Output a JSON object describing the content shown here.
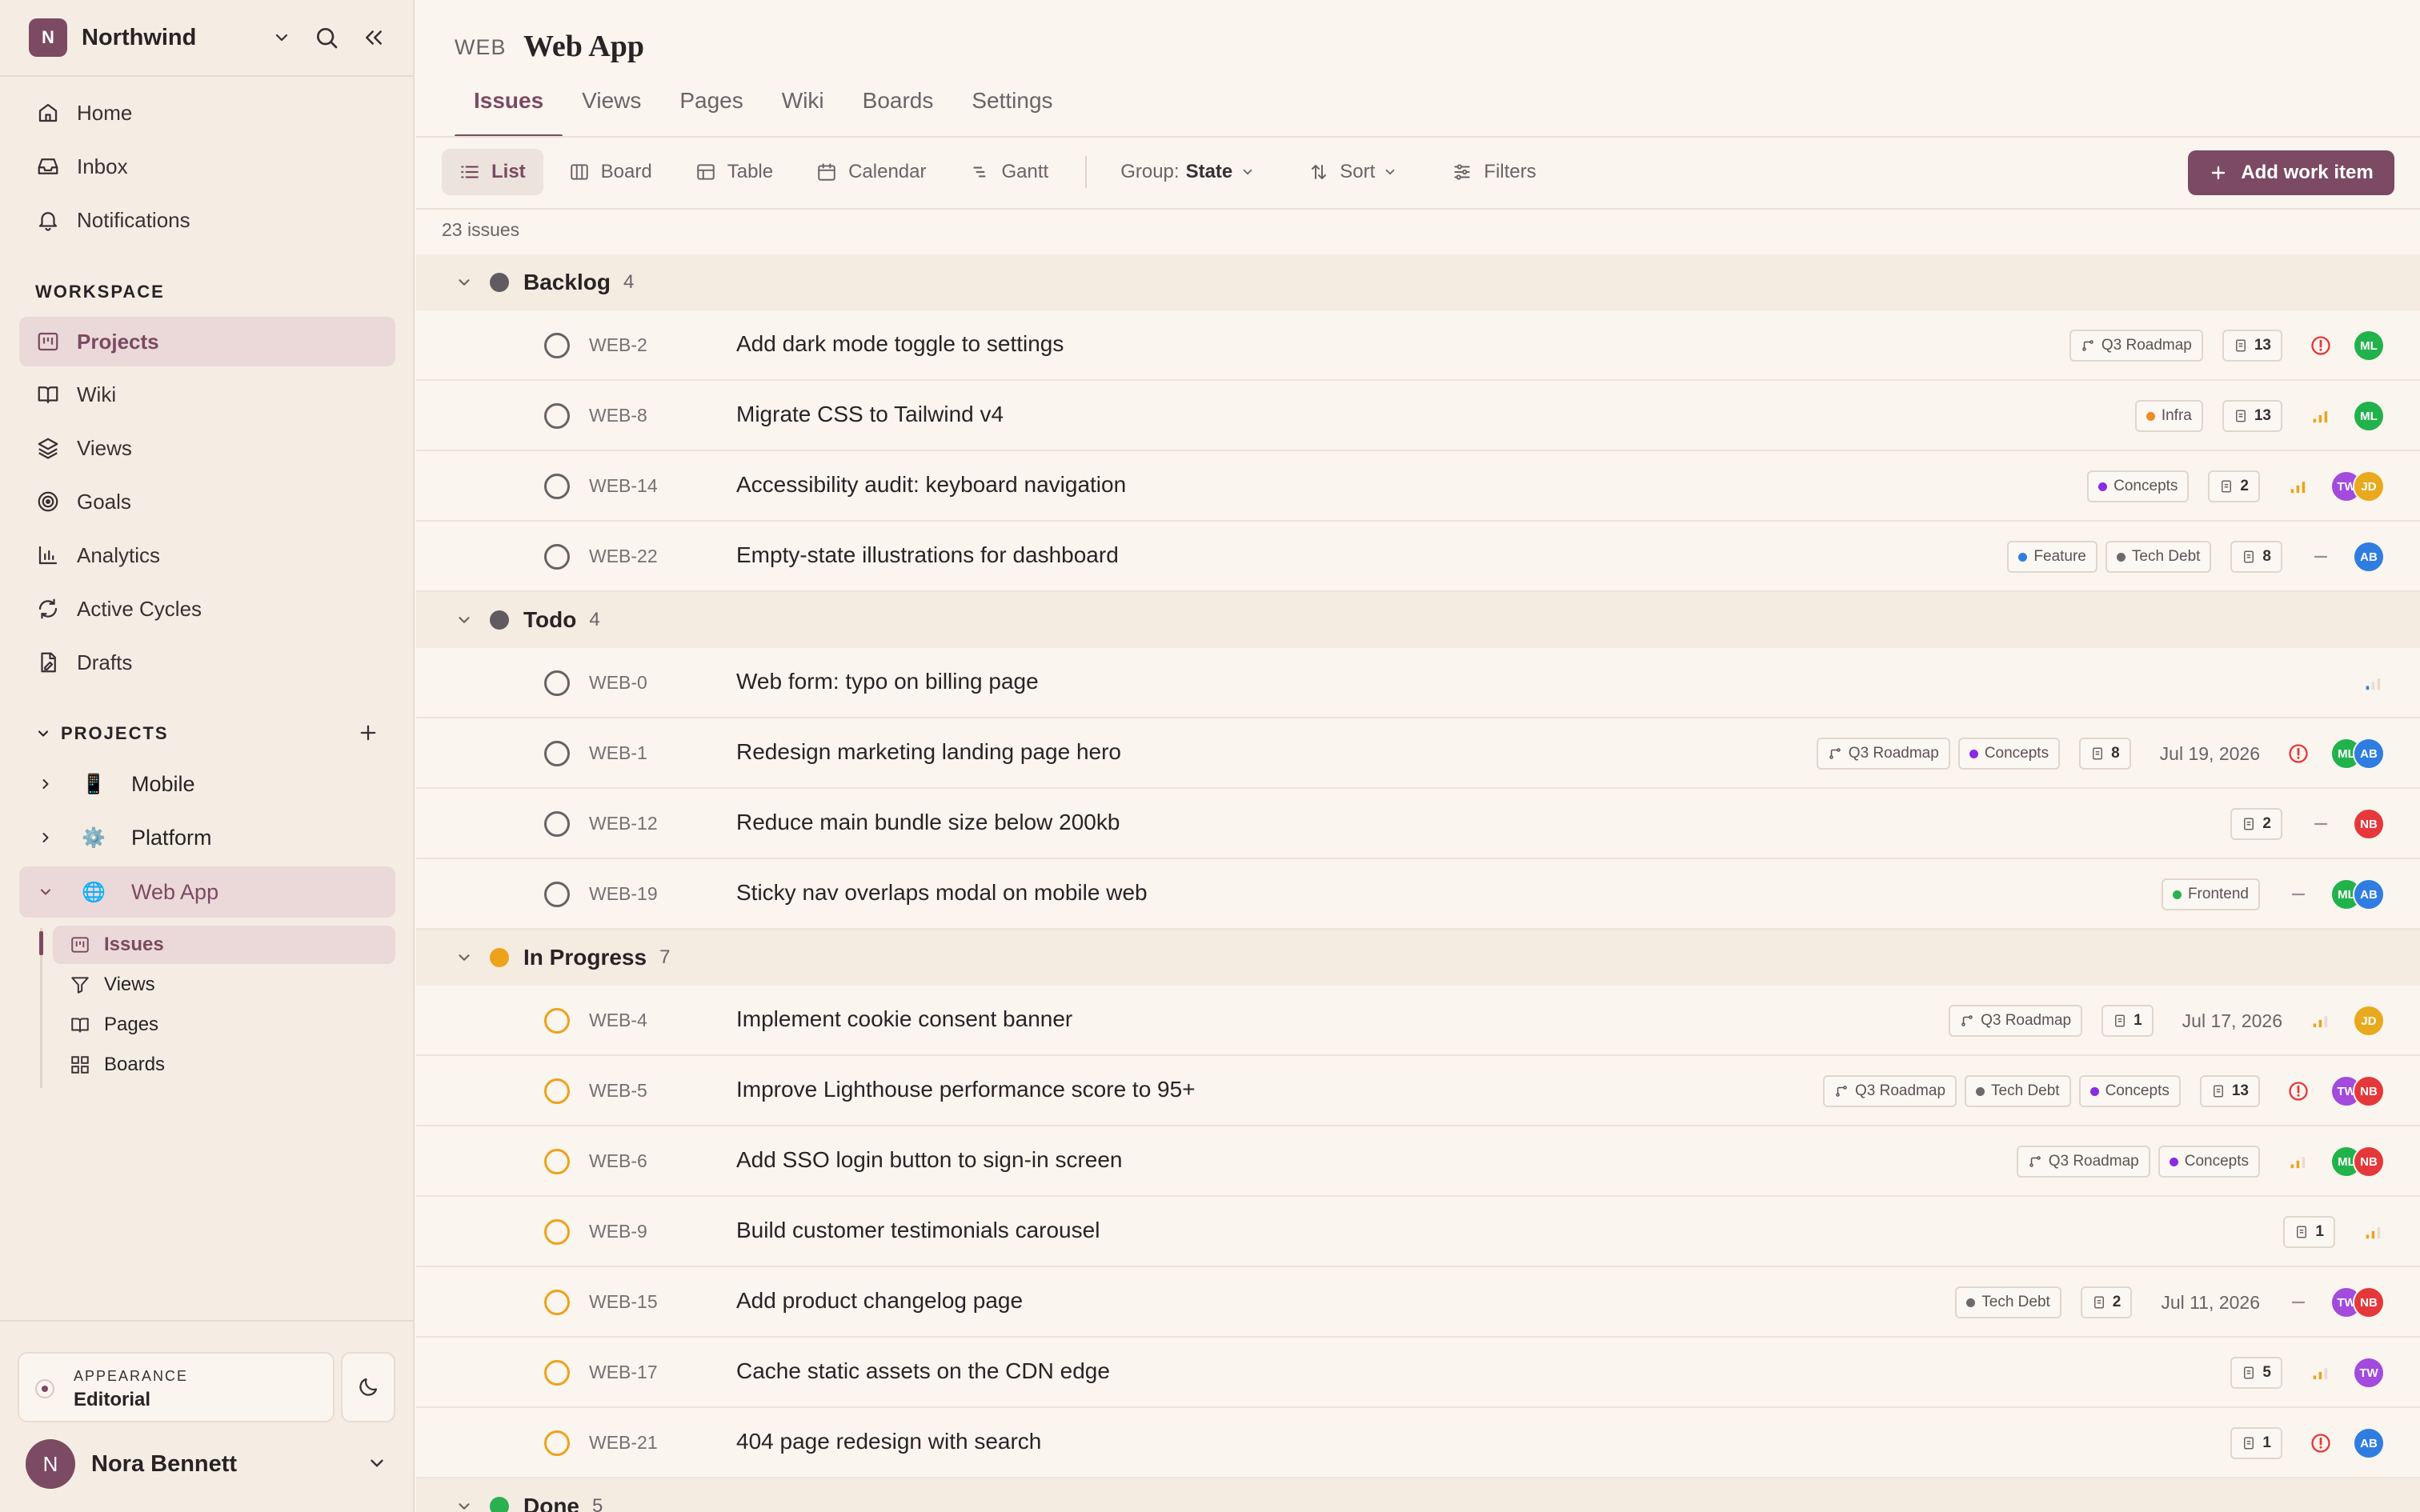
{
  "workspace": {
    "initial": "N",
    "name": "Northwind"
  },
  "nav": [
    {
      "label": "Home",
      "icon": "home-icon"
    },
    {
      "label": "Inbox",
      "icon": "inbox-icon"
    },
    {
      "label": "Notifications",
      "icon": "bell-icon"
    }
  ],
  "workspace_section": {
    "label": "WORKSPACE",
    "items": [
      {
        "label": "Projects",
        "icon": "projects-icon",
        "active": true
      },
      {
        "label": "Wiki",
        "icon": "book-icon"
      },
      {
        "label": "Views",
        "icon": "layers-icon"
      },
      {
        "label": "Goals",
        "icon": "target-icon"
      },
      {
        "label": "Analytics",
        "icon": "chart-icon"
      },
      {
        "label": "Active Cycles",
        "icon": "cycle-icon"
      },
      {
        "label": "Drafts",
        "icon": "draft-icon"
      }
    ]
  },
  "projects_section": {
    "label": "PROJECTS",
    "projects": [
      {
        "label": "Mobile",
        "icon": "📱"
      },
      {
        "label": "Platform",
        "icon": "⚙️"
      },
      {
        "label": "Web App",
        "icon": "🌐"
      }
    ],
    "sub_items": [
      {
        "label": "Issues",
        "icon": "issues-icon"
      },
      {
        "label": "Views",
        "icon": "filter-icon"
      },
      {
        "label": "Pages",
        "icon": "pages-icon"
      },
      {
        "label": "Boards",
        "icon": "grid-icon"
      }
    ]
  },
  "appearance": {
    "label": "APPEARANCE",
    "value": "Editorial"
  },
  "user": {
    "initial": "N",
    "name": "Nora Bennett"
  },
  "header": {
    "project_id": "WEB",
    "project_name": "Web App"
  },
  "tabs": [
    "Issues",
    "Views",
    "Pages",
    "Wiki",
    "Boards",
    "Settings"
  ],
  "toolbar": {
    "layouts": [
      "List",
      "Board",
      "Table",
      "Calendar",
      "Gantt"
    ],
    "group_label": "Group:",
    "group_value": "State",
    "sort_label": "Sort",
    "filters_label": "Filters",
    "add_label": "Add work item"
  },
  "issue_count": "23 issues",
  "colors": {
    "accent": "#7c4a62",
    "backlog": "#5f5b60",
    "todo": "#5f5b60",
    "in_progress": "#eda21c",
    "done": "#2bb04f"
  },
  "groups": [
    {
      "name": "Backlog",
      "count": "4",
      "state": "backlog",
      "issues": [
        {
          "id": "WEB-2",
          "title": "Add dark mode toggle to settings",
          "cycle": "Q3 Roadmap",
          "labels": [],
          "sub": "13",
          "date": "",
          "priority": "urgent",
          "assignees": [
            "ML"
          ]
        },
        {
          "id": "WEB-8",
          "title": "Migrate CSS to Tailwind v4",
          "cycle": "",
          "labels": [
            {
              "name": "Infra",
              "color": "#f08a24"
            }
          ],
          "sub": "13",
          "date": "",
          "priority": "high",
          "assignees": [
            "ML"
          ]
        },
        {
          "id": "WEB-14",
          "title": "Accessibility audit: keyboard navigation",
          "cycle": "",
          "labels": [
            {
              "name": "Concepts",
              "color": "#8a2be2"
            }
          ],
          "sub": "2",
          "date": "",
          "priority": "high",
          "assignees": [
            "TW",
            "JD"
          ]
        },
        {
          "id": "WEB-22",
          "title": "Empty-state illustrations for dashboard",
          "cycle": "",
          "labels": [
            {
              "name": "Feature",
              "color": "#2f7de1"
            },
            {
              "name": "Tech Debt",
              "color": "#6b6b6b"
            }
          ],
          "sub": "8",
          "date": "",
          "priority": "none",
          "assignees": [
            "AB"
          ]
        }
      ]
    },
    {
      "name": "Todo",
      "count": "4",
      "state": "todo",
      "issues": [
        {
          "id": "WEB-0",
          "title": "Web form: typo on billing page",
          "cycle": "",
          "labels": [],
          "sub": "",
          "date": "",
          "priority": "low",
          "assignees": []
        },
        {
          "id": "WEB-1",
          "title": "Redesign marketing landing page hero",
          "cycle": "Q3 Roadmap",
          "labels": [
            {
              "name": "Concepts",
              "color": "#8a2be2"
            }
          ],
          "sub": "8",
          "date": "Jul 19, 2026",
          "priority": "urgent",
          "assignees": [
            "ML",
            "AB"
          ]
        },
        {
          "id": "WEB-12",
          "title": "Reduce main bundle size below 200kb",
          "cycle": "",
          "labels": [],
          "sub": "2",
          "date": "",
          "priority": "none",
          "assignees": [
            "NB"
          ]
        },
        {
          "id": "WEB-19",
          "title": "Sticky nav overlaps modal on mobile web",
          "cycle": "",
          "labels": [
            {
              "name": "Frontend",
              "color": "#2bb04f"
            }
          ],
          "sub": "",
          "date": "",
          "priority": "none",
          "assignees": [
            "ML",
            "AB"
          ]
        }
      ]
    },
    {
      "name": "In Progress",
      "count": "7",
      "state": "in_progress",
      "issues": [
        {
          "id": "WEB-4",
          "title": "Implement cookie consent banner",
          "cycle": "Q3 Roadmap",
          "labels": [],
          "sub": "1",
          "date": "Jul 17, 2026",
          "priority": "medium",
          "assignees": [
            "JD"
          ]
        },
        {
          "id": "WEB-5",
          "title": "Improve Lighthouse performance score to 95+",
          "cycle": "Q3 Roadmap",
          "labels": [
            {
              "name": "Tech Debt",
              "color": "#6b6b6b"
            },
            {
              "name": "Concepts",
              "color": "#8a2be2"
            }
          ],
          "sub": "13",
          "date": "",
          "priority": "urgent",
          "assignees": [
            "TW",
            "NB"
          ]
        },
        {
          "id": "WEB-6",
          "title": "Add SSO login button to sign-in screen",
          "cycle": "Q3 Roadmap",
          "labels": [
            {
              "name": "Concepts",
              "color": "#8a2be2"
            }
          ],
          "sub": "",
          "date": "",
          "priority": "medium",
          "assignees": [
            "ML",
            "NB"
          ]
        },
        {
          "id": "WEB-9",
          "title": "Build customer testimonials carousel",
          "cycle": "",
          "labels": [],
          "sub": "1",
          "date": "",
          "priority": "medium",
          "assignees": []
        },
        {
          "id": "WEB-15",
          "title": "Add product changelog page",
          "cycle": "",
          "labels": [
            {
              "name": "Tech Debt",
              "color": "#6b6b6b"
            }
          ],
          "sub": "2",
          "date": "Jul 11, 2026",
          "priority": "none",
          "assignees": [
            "TW",
            "NB"
          ]
        },
        {
          "id": "WEB-17",
          "title": "Cache static assets on the CDN edge",
          "cycle": "",
          "labels": [],
          "sub": "5",
          "date": "",
          "priority": "medium",
          "assignees": [
            "TW"
          ]
        },
        {
          "id": "WEB-21",
          "title": "404 page redesign with search",
          "cycle": "",
          "labels": [],
          "sub": "1",
          "date": "",
          "priority": "urgent",
          "assignees": [
            "AB"
          ]
        }
      ]
    },
    {
      "name": "Done",
      "count": "5",
      "state": "done",
      "issues": []
    }
  ],
  "avatar_colors": {
    "ML": "#22b24c",
    "TW": "#a24bdc",
    "JD": "#e9a91c",
    "AB": "#2f7de1",
    "NB": "#e5383b"
  }
}
